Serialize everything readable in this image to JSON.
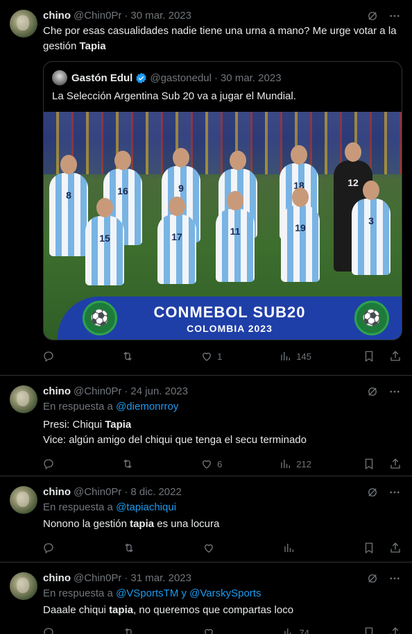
{
  "tweets": [
    {
      "name": "chino",
      "handle": "@Chin0Pr",
      "sep": "·",
      "date": "30 mar. 2023",
      "text_before": "Che por esas casualidades nadie tiene una urna a mano? Me urge votar a la gestión ",
      "text_bold": "Tapia",
      "text_after": "",
      "quote": {
        "name": "Gastón Edul",
        "handle": "@gastonedul",
        "sep": "·",
        "date": "30 mar. 2023",
        "text": "La Selección Argentina Sub 20 va a jugar el Mundial.",
        "image": {
          "banner_title": "CONMEBOL SUB20",
          "banner_subtitle": "COLOMBIA 2023",
          "jersey_numbers_back": [
            "8",
            "16",
            "9",
            "",
            "18",
            "12"
          ],
          "jersey_numbers_front": [
            "15",
            "17",
            "11",
            "19",
            "3"
          ]
        }
      },
      "actions": {
        "replies": "",
        "retweets": "",
        "likes": "1",
        "views": "145"
      }
    },
    {
      "name": "chino",
      "handle": "@Chin0Pr",
      "sep": "·",
      "date": "24 jun. 2023",
      "reply_prefix": "En respuesta a ",
      "reply_to": "@diemonrroy",
      "line1_before": "Presi: Chiqui ",
      "line1_bold": "Tapia",
      "line2": "Vice: algún amigo del chiqui que tenga el secu terminado",
      "actions": {
        "replies": "",
        "retweets": "",
        "likes": "6",
        "views": "212"
      }
    },
    {
      "name": "chino",
      "handle": "@Chin0Pr",
      "sep": "·",
      "date": "8 dic. 2022",
      "reply_prefix": "En respuesta a ",
      "reply_to": "@tapiachiqui",
      "text_before": "Nonono la gestión ",
      "text_bold": "tapia",
      "text_after": " es una locura",
      "actions": {
        "replies": "",
        "retweets": "",
        "likes": "",
        "views": ""
      }
    },
    {
      "name": "chino",
      "handle": "@Chin0Pr",
      "sep": "·",
      "date": "31 mar. 2023",
      "reply_prefix": "En respuesta a ",
      "reply_to": "@VSportsTM y @VarskySports",
      "text_before": "Daaale chiqui ",
      "text_bold": "tapia",
      "text_after": ", no queremos que compartas loco",
      "actions": {
        "replies": "",
        "retweets": "",
        "likes": "",
        "views": "74"
      }
    }
  ],
  "icons": {
    "grok": "grok-icon",
    "more": "more-icon",
    "reply": "reply-icon",
    "retweet": "retweet-icon",
    "like": "heart-icon",
    "views": "views-icon",
    "bookmark": "bookmark-icon",
    "share": "share-icon",
    "verified": "verified-badge-icon"
  },
  "colors": {
    "background": "#000000",
    "text": "#e7e9ea",
    "muted": "#71767b",
    "link": "#1d9bf0",
    "border": "#2f3336"
  }
}
